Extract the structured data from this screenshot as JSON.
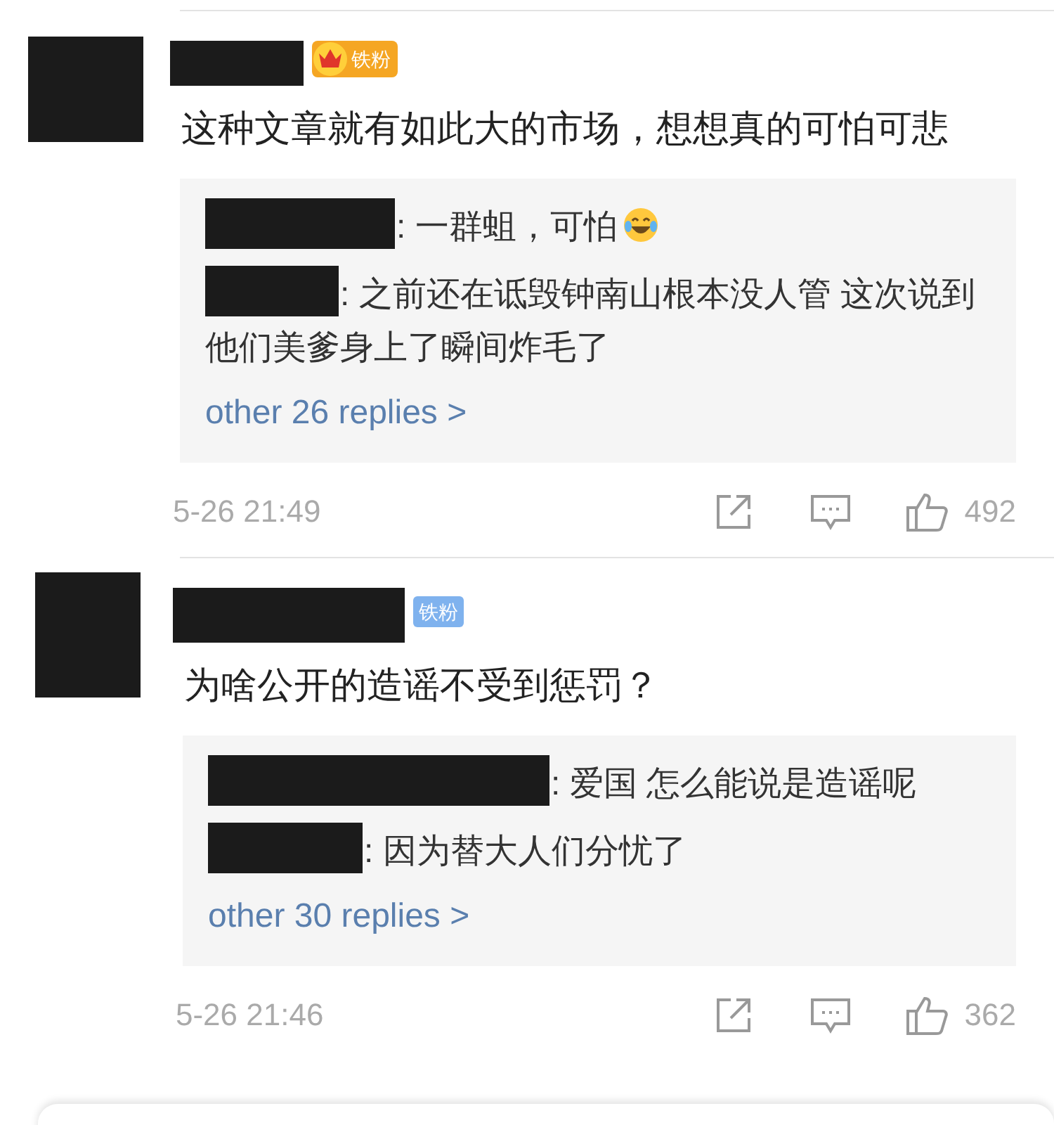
{
  "comments": [
    {
      "badge": {
        "kind": "crown",
        "label": "铁粉"
      },
      "text": "这种文章就有如此大的市场，想想真的可怕可悲",
      "replies": [
        {
          "text": ": 一群蛆，可怕",
          "emoji": true
        },
        {
          "text": ": 之前还在诋毁钟南山根本没人管 这次说到他们美爹身上了瞬间炸毛了",
          "emoji": false
        }
      ],
      "more": "other 26 replies >",
      "time": "5-26 21:49",
      "likes": "492"
    },
    {
      "badge": {
        "kind": "plain",
        "label": "铁粉"
      },
      "text": "为啥公开的造谣不受到惩罚？",
      "replies": [
        {
          "text": ": 爱国 怎么能说是造谣呢",
          "emoji": false
        },
        {
          "text": ": 因为替大人们分忧了",
          "emoji": false
        }
      ],
      "more": "other 30 replies >",
      "time": "5-26 21:46",
      "likes": "362"
    }
  ]
}
